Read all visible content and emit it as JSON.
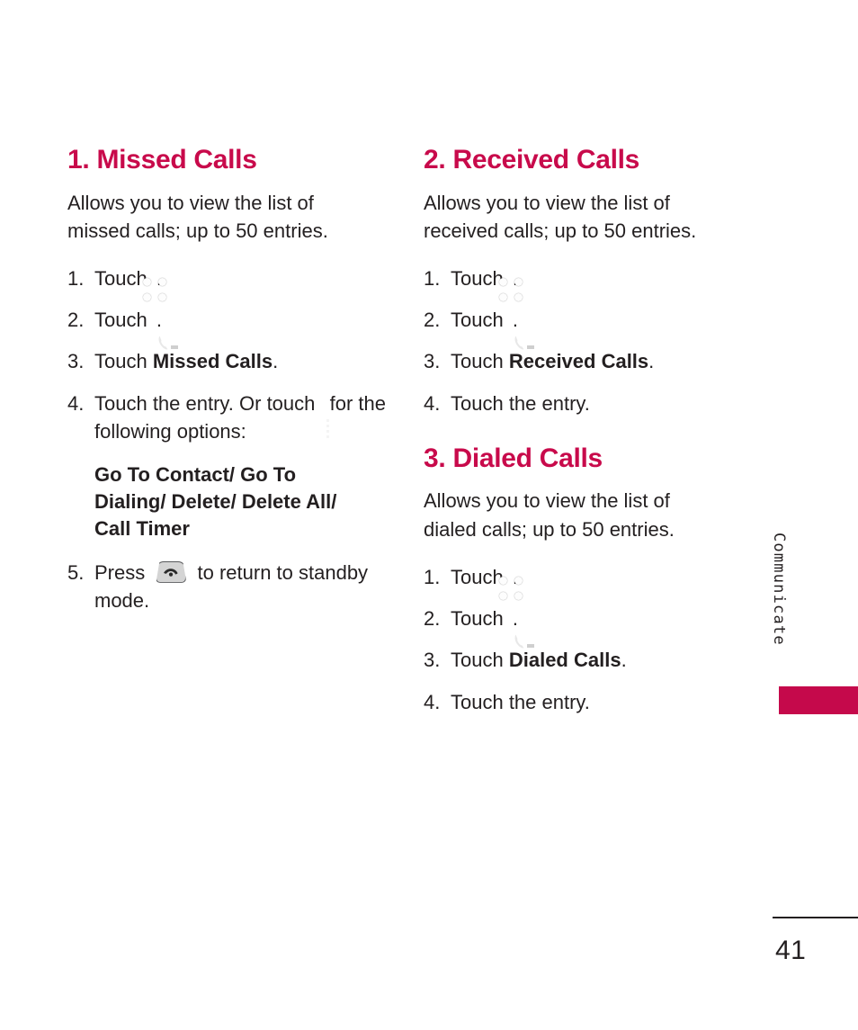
{
  "page": {
    "number": "41",
    "side_tab_label": "Communicate",
    "accent_color": "#c80a4b",
    "tab_bar_color": "#c5094b",
    "text_color": "#231f20"
  },
  "left_column": {
    "sections": [
      {
        "heading": "1. Missed Calls",
        "intro": "Allows you to view the list of missed calls; up to 50 entries.",
        "steps": [
          {
            "num": "1.",
            "text_before": "Touch",
            "icon": "grid-icon",
            "text_after": "."
          },
          {
            "num": "2.",
            "text_before": "Touch",
            "icon": "call-log-icon",
            "text_after": "."
          },
          {
            "num": "3.",
            "text_before": "Touch",
            "bold": "Missed Calls",
            "text_after": "."
          },
          {
            "num": "4.",
            "text_before": "Touch the entry. Or touch",
            "icon": "options-list-icon",
            "text_after": "for the following options:"
          },
          {
            "num": "5.",
            "text_before": "Press",
            "icon": "end-call-key-icon",
            "text_after": "to return to standby mode."
          }
        ],
        "options_text": "Go To Contact/ Go To Dialing/ Delete/ Delete All/ Call Timer"
      }
    ]
  },
  "right_column": {
    "sections": [
      {
        "heading": "2. Received Calls",
        "intro": "Allows you to view the list of received calls; up to 50 entries.",
        "steps": [
          {
            "num": "1.",
            "text_before": "Touch",
            "icon": "grid-icon",
            "text_after": "."
          },
          {
            "num": "2.",
            "text_before": "Touch",
            "icon": "call-log-icon",
            "text_after": "."
          },
          {
            "num": "3.",
            "text_before": "Touch",
            "bold": "Received Calls",
            "text_after": "."
          },
          {
            "num": "4.",
            "text_before": "Touch the entry.",
            "icon": null,
            "text_after": ""
          }
        ]
      },
      {
        "heading": "3. Dialed Calls",
        "intro": "Allows you to view the list of dialed calls; up to 50 entries.",
        "steps": [
          {
            "num": "1.",
            "text_before": "Touch",
            "icon": "grid-icon",
            "text_after": "."
          },
          {
            "num": "2.",
            "text_before": "Touch",
            "icon": "call-log-icon",
            "text_after": "."
          },
          {
            "num": "3.",
            "text_before": "Touch",
            "bold": "Dialed Calls",
            "text_after": "."
          },
          {
            "num": "4.",
            "text_before": "Touch the entry.",
            "icon": null,
            "text_after": ""
          }
        ]
      }
    ]
  }
}
